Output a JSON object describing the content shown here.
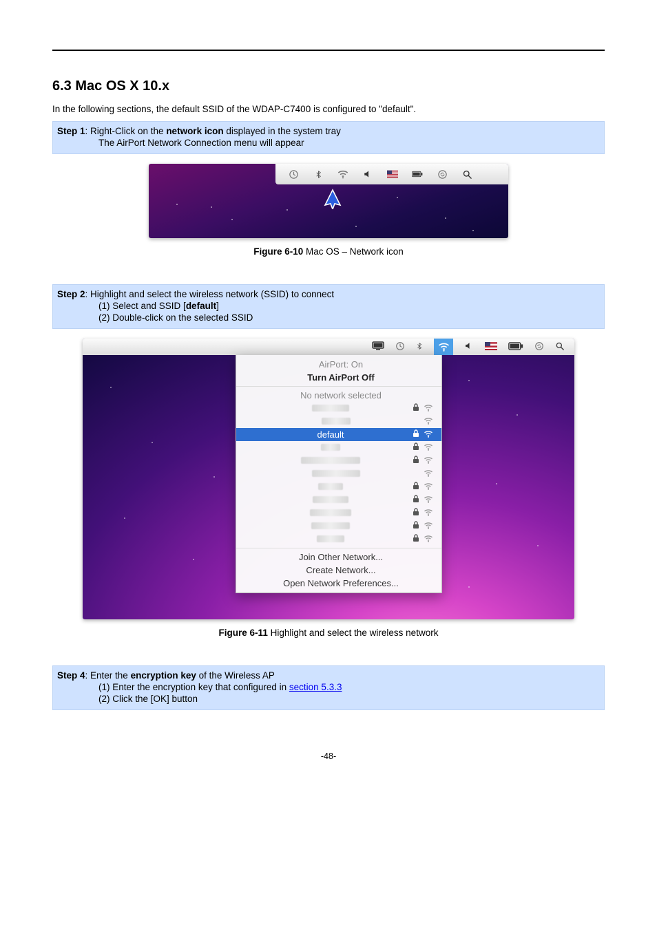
{
  "page_number": "-48-",
  "heading": "6.3  Mac OS X 10.x",
  "intro": "In the following sections, the default SSID of the WDAP-C7400 is configured to \"default\".",
  "step1": {
    "prefix": "Step 1",
    "line": ": Right-Click on the ",
    "bold": "network icon",
    "tail": " displayed in the system tray",
    "sub": "The AirPort Network Connection menu will appear"
  },
  "fig10": {
    "label_bold": "Figure 6-10",
    "label_rest": " Mac OS – Network icon"
  },
  "step2": {
    "prefix": "Step 2",
    "line": ": Highlight and select the wireless network (SSID) to connect",
    "ol1_pre": "(1)  Select and SSID [",
    "ol1_bold": "default",
    "ol1_post": "]",
    "ol2": "(2)  Double-click on the selected SSID"
  },
  "airport": {
    "status": "AirPort: On",
    "turn_off": "Turn AirPort Off",
    "no_net": "No network selected",
    "selected_ssid": "default",
    "join_other": "Join Other Network...",
    "create": "Create Network...",
    "open_prefs": "Open Network Preferences...",
    "blurred_widths": [
      54,
      42,
      28,
      86,
      70,
      36,
      52,
      60,
      56,
      40
    ],
    "rows_above": 2,
    "rows_below": 8,
    "lock_flags_above": [
      true,
      false
    ],
    "lock_flags_below": [
      true,
      true,
      false,
      true,
      true,
      true,
      true,
      true
    ]
  },
  "fig11": {
    "label_bold": "Figure 6-11",
    "label_rest": " Highlight and select the wireless network"
  },
  "step4": {
    "prefix": "Step 4",
    "line": ": Enter the ",
    "bold": "encryption key",
    "tail": " of the Wireless AP",
    "ol1_pre": "(1)  Enter the encryption key that configured in ",
    "ol1_link": "section 5.3.3",
    "ol2": "(2)  Click the [OK] button"
  }
}
